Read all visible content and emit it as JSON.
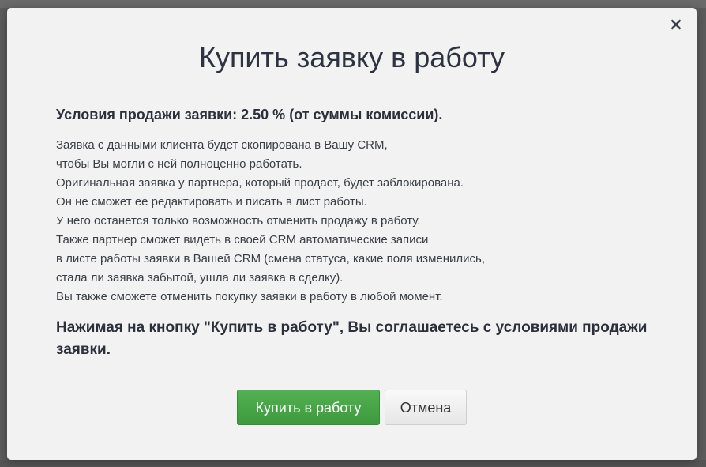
{
  "modal": {
    "title": "Купить заявку в работу",
    "close_label": "×",
    "conditions": "Условия продажи заявки: 2.50 % (от суммы комиссии).",
    "lines": [
      "Заявка с данными клиента будет скопирована в Вашу CRM,",
      "чтобы Вы могли с ней полноценно работать.",
      "Оригинальная заявка у партнера, который продает, будет заблокирована.",
      "Он не сможет ее редактировать и писать в лист работы.",
      "У него останется только возможность отменить продажу в работу.",
      "Также партнер сможет видеть в своей CRM автоматические записи",
      "в листе работы заявки в Вашей CRM (смена статуса, какие поля изменились,",
      "стала ли заявка забытой, ушла ли заявка в сделку).",
      "Вы также сможете отменить покупку заявки в работу в любой момент."
    ],
    "agreement": "Нажимая на кнопку \"Купить в работу\", Вы соглашаетесь с условиями продажи заявки.",
    "buy_label": "Купить в работу",
    "cancel_label": "Отмена"
  },
  "colors": {
    "buy_button": "#449d44",
    "modal_background": "#f2f2f2",
    "overlay": "#5c5c5c"
  }
}
